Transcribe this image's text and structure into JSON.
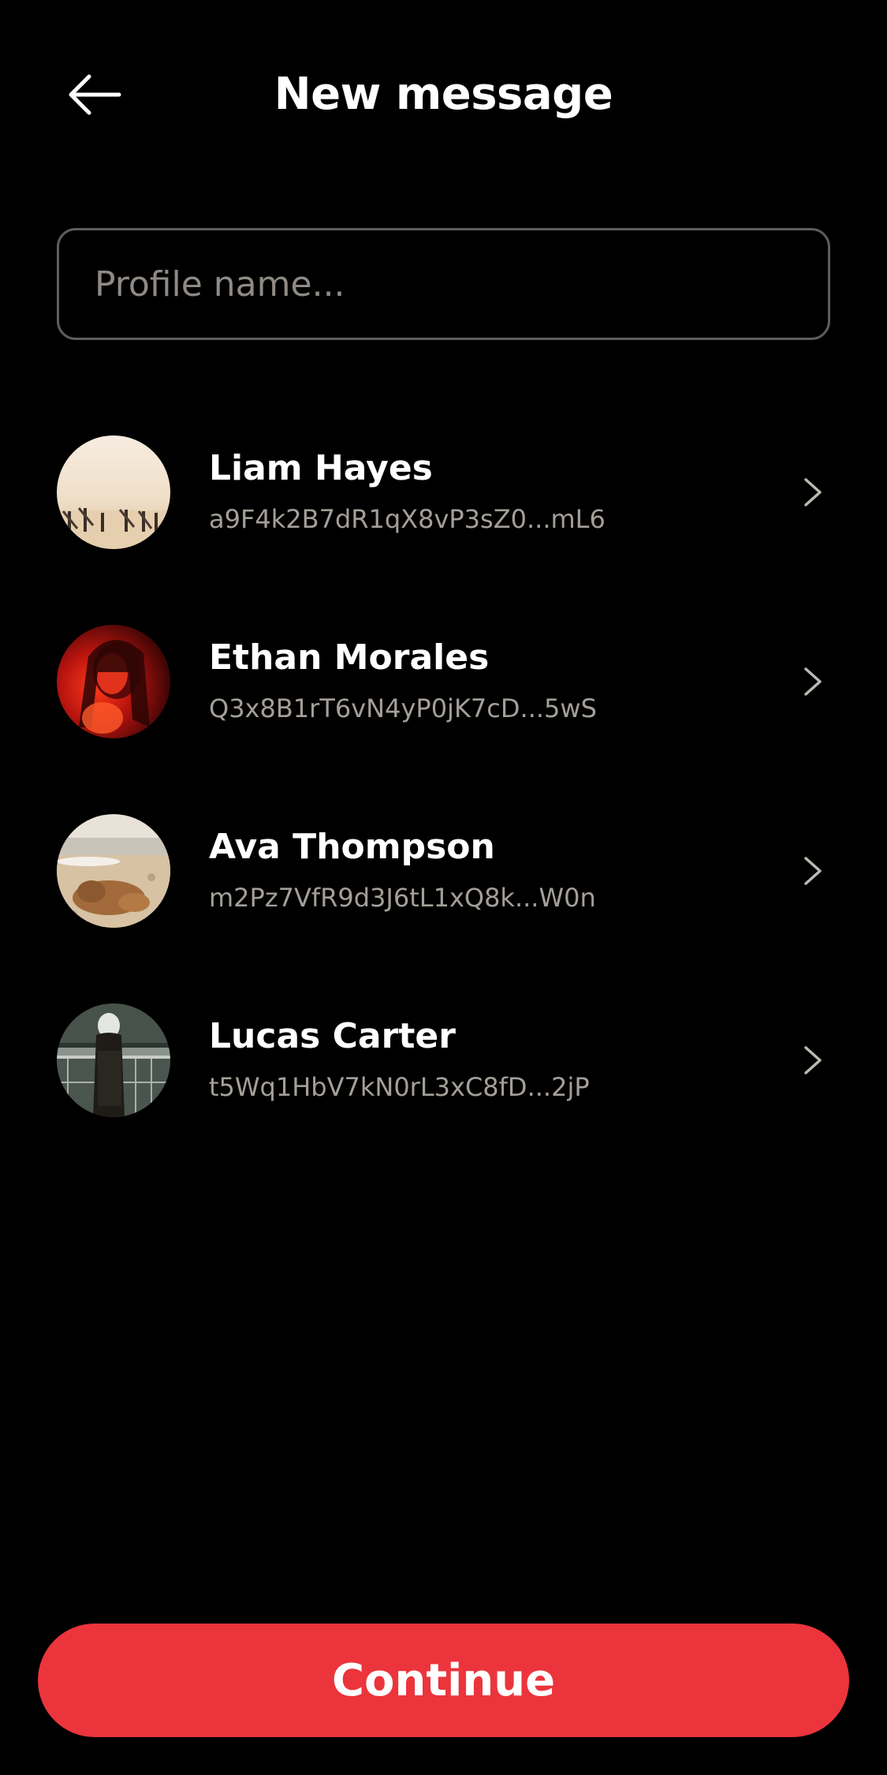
{
  "header": {
    "back_icon": "arrow-left-icon",
    "title": "New message"
  },
  "search": {
    "placeholder": "Profile name...",
    "value": ""
  },
  "contacts": [
    {
      "name": "Liam Hayes",
      "address": "a9F4k2B7dR1qX8vP3sZ0...mL6",
      "avatar": "beach-surfers-photo"
    },
    {
      "name": "Ethan Morales",
      "address": "Q3x8B1rT6vN4yP0jK7cD...5wS",
      "avatar": "red-lit-portrait-photo"
    },
    {
      "name": "Ava Thompson",
      "address": "m2Pz7VfR9d3J6tL1xQ8k...W0n",
      "avatar": "dog-on-beach-photo"
    },
    {
      "name": "Lucas Carter",
      "address": "t5Wq1HbV7kN0rL3xC8fD...2jP",
      "avatar": "hooded-person-photo"
    }
  ],
  "footer": {
    "continue_label": "Continue"
  },
  "colors": {
    "background": "#000000",
    "accent": "#ec343c",
    "secondary_text": "#a49f99",
    "input_border": "#5f5d5a"
  }
}
